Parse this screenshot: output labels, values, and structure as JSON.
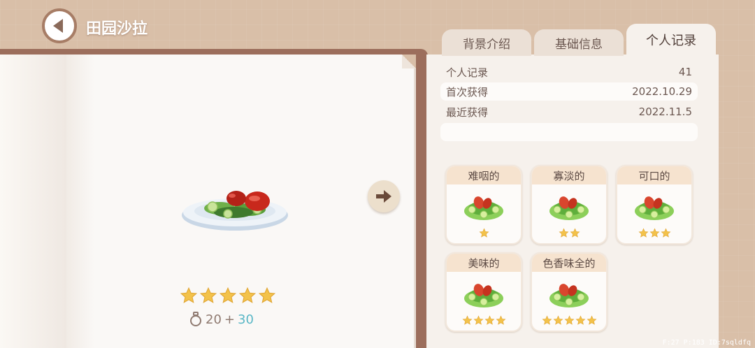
{
  "header": {
    "title": "田园沙拉"
  },
  "tabs": [
    {
      "label": "背景介绍",
      "active": false
    },
    {
      "label": "基础信息",
      "active": false
    },
    {
      "label": "个人记录",
      "active": true
    }
  ],
  "dish": {
    "star_rating": 5,
    "max_stars": 5,
    "price_base": "20",
    "price_plus": "+",
    "price_bonus": "30"
  },
  "records": [
    {
      "label": "个人记录",
      "value": "41"
    },
    {
      "label": "首次获得",
      "value": "2022.10.29"
    },
    {
      "label": "最近获得",
      "value": "2022.11.5"
    }
  ],
  "quality_cards": [
    {
      "label": "难咽的",
      "stars": 1
    },
    {
      "label": "寡淡的",
      "stars": 2
    },
    {
      "label": "可口的",
      "stars": 3
    },
    {
      "label": "美味的",
      "stars": 4
    },
    {
      "label": "色香味全的",
      "stars": 5
    }
  ],
  "footer": {
    "debug": "F:27   P:183   ID:7sqldfq"
  },
  "colors": {
    "star": "#f3c24a",
    "accent_bonus": "#5ab7c6",
    "tab_active": "#f6f1ec"
  }
}
